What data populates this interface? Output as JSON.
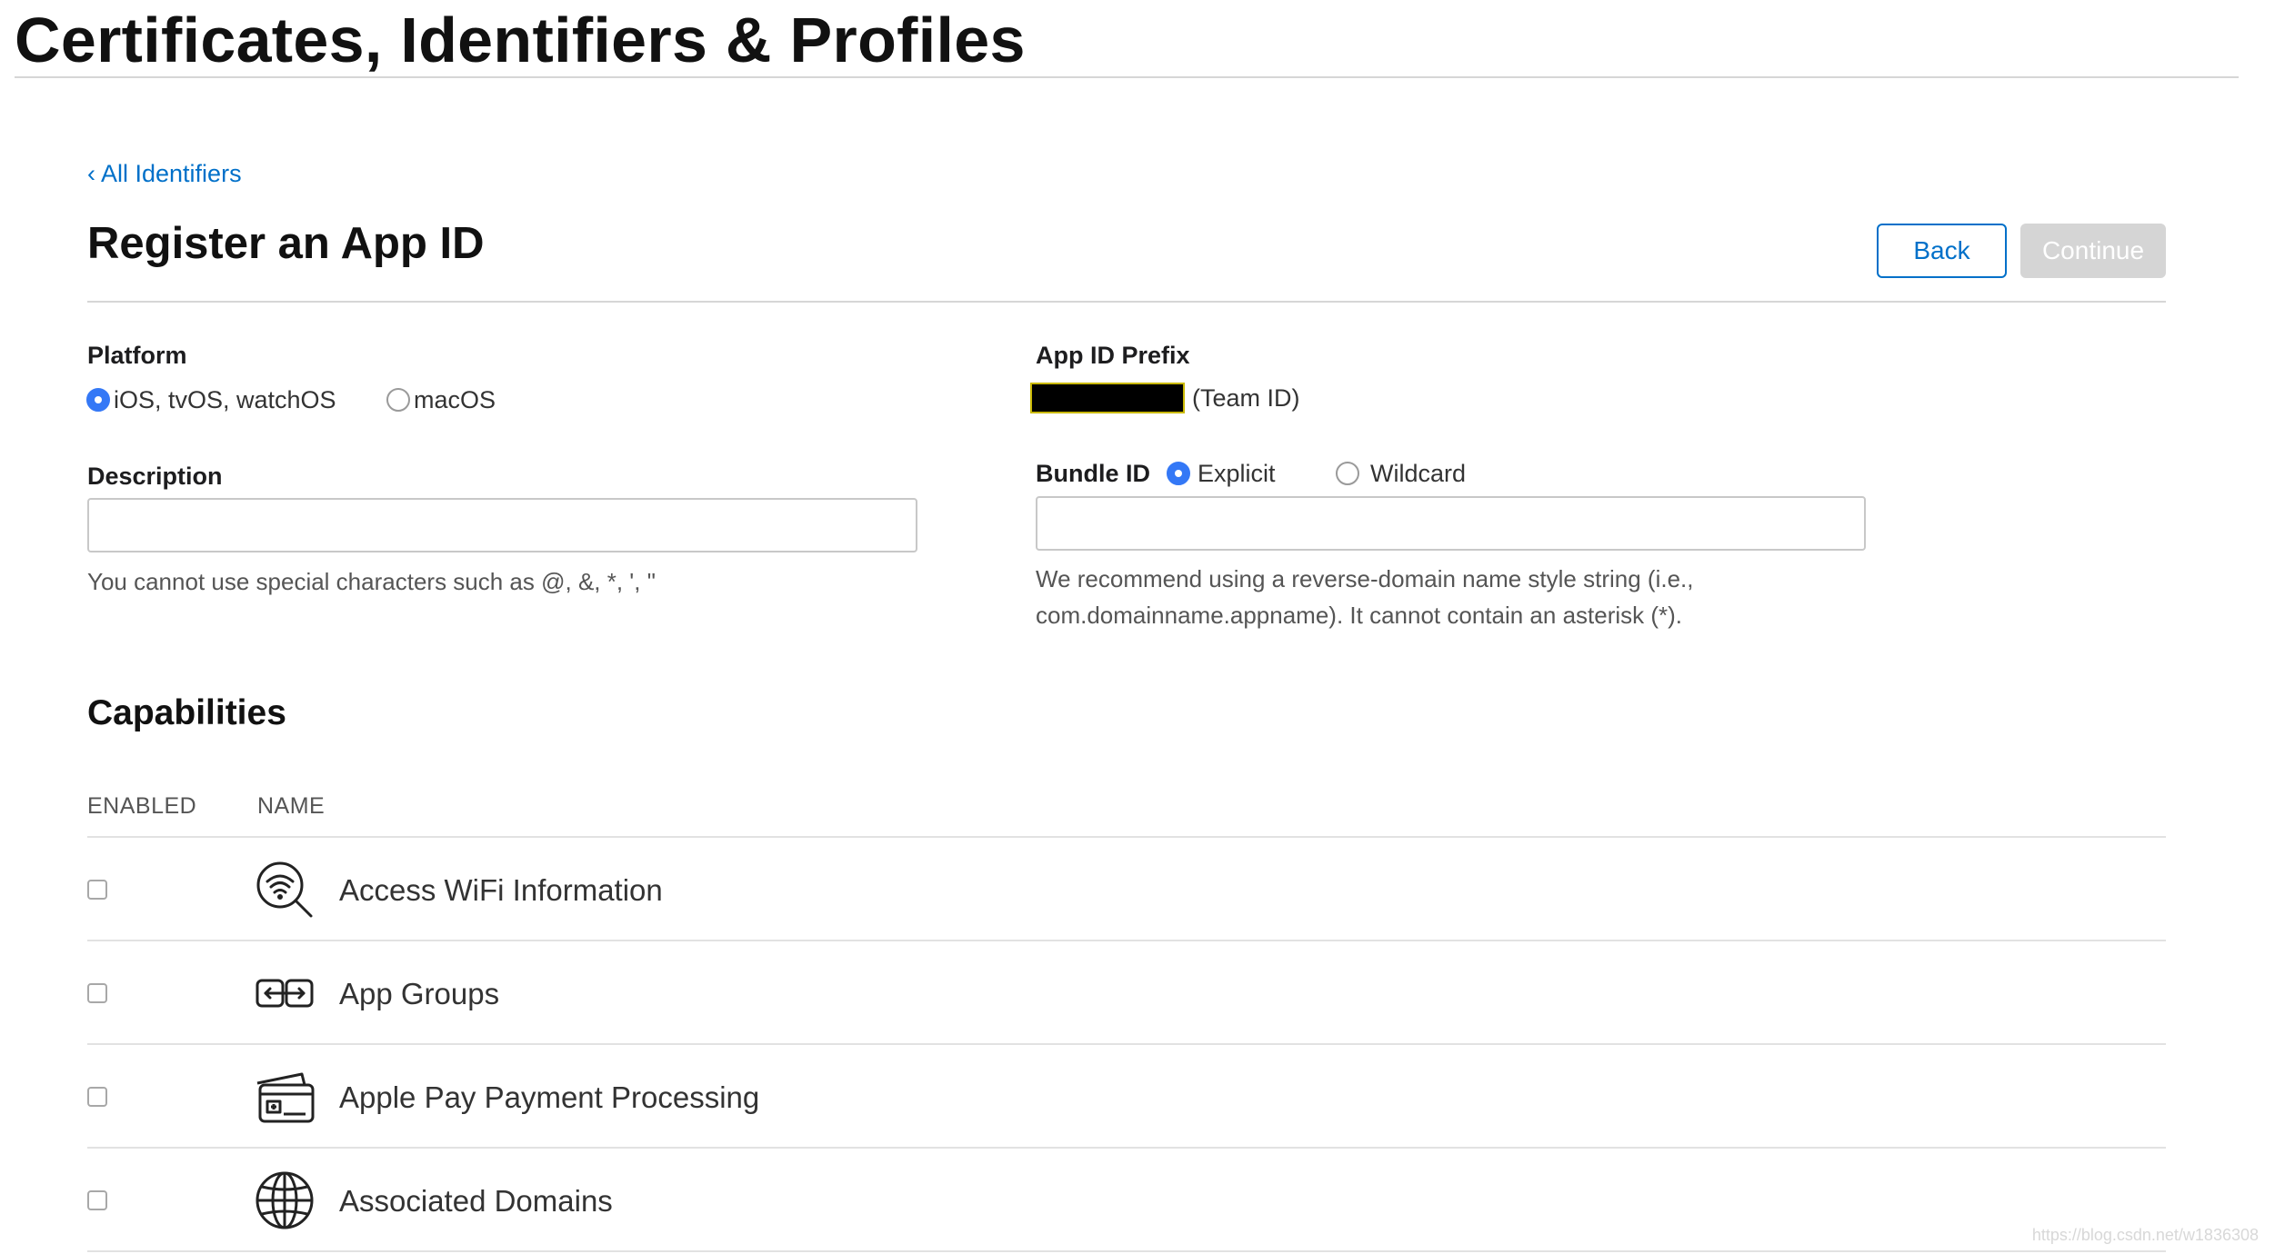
{
  "page": {
    "heading": "Certificates, Identifiers & Profiles"
  },
  "nav": {
    "back_link": "All Identifiers"
  },
  "form": {
    "title": "Register an App ID",
    "back_button": "Back",
    "continue_button": "Continue",
    "platform": {
      "label": "Platform",
      "options": [
        {
          "label": "iOS, tvOS, watchOS",
          "selected": true
        },
        {
          "label": "macOS",
          "selected": false
        }
      ]
    },
    "description": {
      "label": "Description",
      "value": "",
      "help": "You cannot use special characters such as @, &, *, ', \""
    },
    "app_id_prefix": {
      "label": "App ID Prefix",
      "suffix": "(Team ID)"
    },
    "bundle_id": {
      "label": "Bundle ID",
      "options": [
        {
          "label": "Explicit",
          "selected": true
        },
        {
          "label": "Wildcard",
          "selected": false
        }
      ],
      "value": "",
      "help_line1": "We recommend using a reverse-domain name style string (i.e.,",
      "help_line2": "com.domainname.appname). It cannot contain an asterisk (*)."
    }
  },
  "capabilities": {
    "title": "Capabilities",
    "columns": {
      "enabled": "ENABLED",
      "name": "NAME"
    },
    "items": [
      {
        "name": "Access WiFi Information",
        "icon": "wifi-search-icon",
        "enabled": false
      },
      {
        "name": "App Groups",
        "icon": "app-groups-icon",
        "enabled": false
      },
      {
        "name": "Apple Pay Payment Processing",
        "icon": "wallet-card-icon",
        "enabled": false
      },
      {
        "name": "Associated Domains",
        "icon": "globe-icon",
        "enabled": false
      }
    ]
  },
  "watermark": "https://blog.csdn.net/w1836308"
}
